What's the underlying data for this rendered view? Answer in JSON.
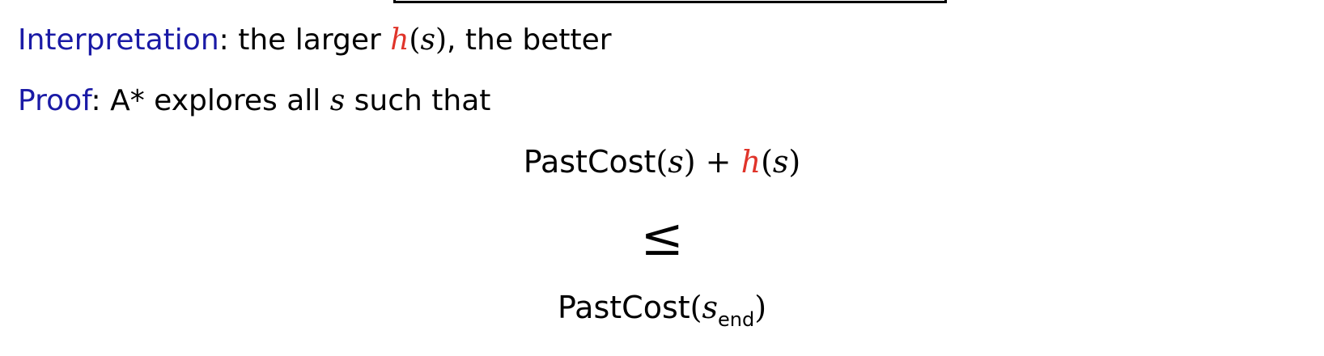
{
  "interpretation": {
    "keyword": "Interpretation",
    "sep": ": the larger ",
    "h": "h",
    "arg": "(s)",
    "rest": ", the better"
  },
  "proof": {
    "keyword": "Proof",
    "sep": ": A* explores all ",
    "var": "s",
    "rest": " such that"
  },
  "equation": {
    "lhs_name": "PastCost",
    "lhs_arg": "(s)",
    "plus": " + ",
    "h": "h",
    "h_arg": "(s)",
    "relation": "≤",
    "rhs_name": "PastCost",
    "rhs_open": "(s",
    "rhs_sub": "end",
    "rhs_close": ")"
  },
  "colors": {
    "keyword": "#1a1aa6",
    "heuristic": "#e0342a"
  }
}
